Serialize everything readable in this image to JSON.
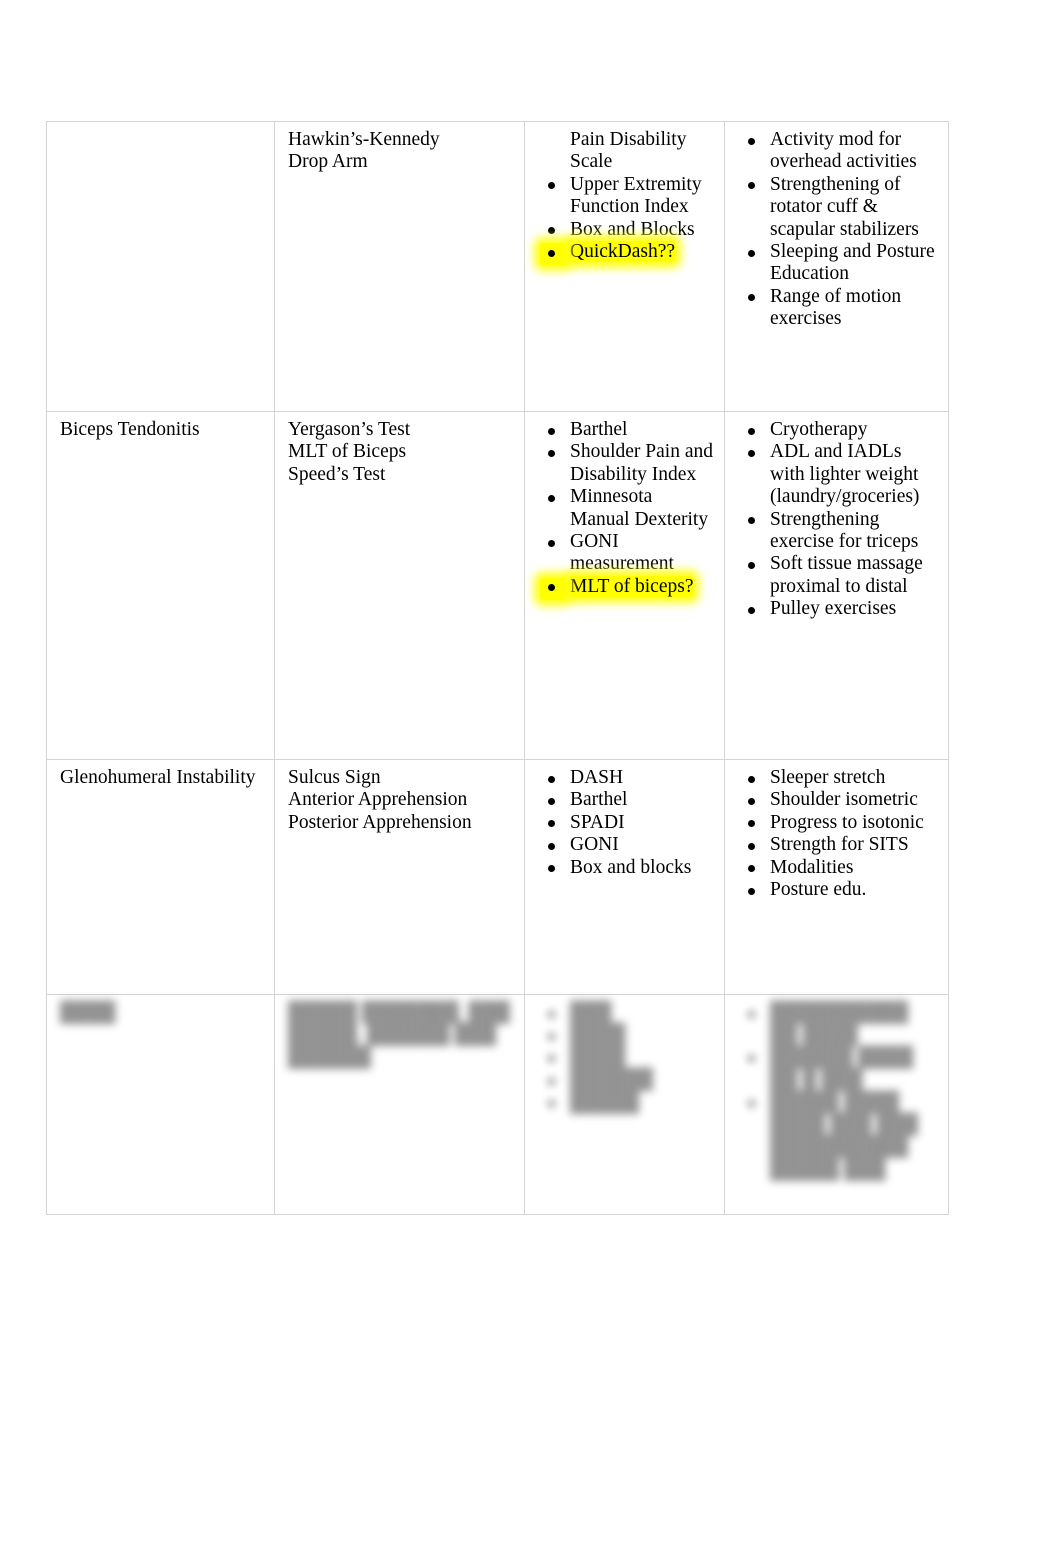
{
  "document": {
    "type": "table",
    "page_background": "#ffffff",
    "border_color": "#d4d4d4",
    "highlight_color": "#ffff00",
    "text_color": "#000000"
  },
  "table": {
    "columns": [
      {
        "key": "condition",
        "header_visible": false
      },
      {
        "key": "special_tests",
        "header_visible": false
      },
      {
        "key": "outcome_measures",
        "header_visible": false
      },
      {
        "key": "interventions",
        "header_visible": false
      }
    ],
    "rows": [
      {
        "id": "row-continued-impingement",
        "blurred": false,
        "condition": {
          "lines": []
        },
        "special_tests": {
          "lines": [
            "Hawkin’s-Kennedy",
            "Drop Arm"
          ]
        },
        "outcome_measures": {
          "items": [
            {
              "text": "Pain Disability Scale",
              "bullet": false,
              "highlight": false
            },
            {
              "text": "Upper Extremity Function Index",
              "bullet": true,
              "highlight": false
            },
            {
              "text": "Box and Blocks",
              "bullet": true,
              "highlight": false
            },
            {
              "text": "QuickDash??",
              "bullet": true,
              "highlight": true
            }
          ]
        },
        "interventions": {
          "items": [
            {
              "text": "Activity mod for overhead activities",
              "bullet": true,
              "highlight": false
            },
            {
              "text": "Strengthening of rotator cuff & scapular stabilizers",
              "bullet": true,
              "highlight": false
            },
            {
              "text": "Sleeping and Posture Education",
              "bullet": true,
              "highlight": false
            },
            {
              "text": "Range of motion exercises",
              "bullet": true,
              "highlight": false
            }
          ]
        }
      },
      {
        "id": "row-biceps-tendonitis",
        "blurred": false,
        "condition": {
          "lines": [
            "Biceps Tendonitis"
          ]
        },
        "special_tests": {
          "lines": [
            "Yergason’s Test",
            "MLT of Biceps",
            "Speed’s Test"
          ]
        },
        "outcome_measures": {
          "items": [
            {
              "text": "Barthel",
              "bullet": true,
              "highlight": false
            },
            {
              "text": "Shoulder Pain and Disability Index",
              "bullet": true,
              "highlight": false
            },
            {
              "text": "Minnesota Manual Dexterity",
              "bullet": true,
              "highlight": false
            },
            {
              "text": "GONI measurement",
              "bullet": true,
              "highlight": false
            },
            {
              "text": "MLT of biceps?",
              "bullet": true,
              "highlight": true
            }
          ]
        },
        "interventions": {
          "items": [
            {
              "text": "Cryotherapy",
              "bullet": true,
              "highlight": false
            },
            {
              "text": "ADL and IADLs with lighter weight (laundry/groceries)",
              "bullet": true,
              "highlight": false
            },
            {
              "text": "Strengthening exercise for triceps",
              "bullet": true,
              "highlight": false
            },
            {
              "text": "Soft tissue massage proximal to distal",
              "bullet": true,
              "highlight": false
            },
            {
              "text": "Pulley exercises",
              "bullet": true,
              "highlight": false
            }
          ]
        }
      },
      {
        "id": "row-glenohumeral-instability",
        "blurred": false,
        "condition": {
          "lines": [
            "Glenohumeral Instability"
          ]
        },
        "special_tests": {
          "lines": [
            "Sulcus Sign",
            "Anterior Apprehension",
            "Posterior Apprehension"
          ]
        },
        "outcome_measures": {
          "items": [
            {
              "text": "DASH",
              "bullet": true,
              "highlight": false
            },
            {
              "text": "Barthel",
              "bullet": true,
              "highlight": false
            },
            {
              "text": "SPADI",
              "bullet": true,
              "highlight": false
            },
            {
              "text": "GONI",
              "bullet": true,
              "highlight": false
            },
            {
              "text": "Box and blocks",
              "bullet": true,
              "highlight": false
            }
          ]
        },
        "interventions": {
          "items": [
            {
              "text": "Sleeper stretch",
              "bullet": true,
              "highlight": false
            },
            {
              "text": "Shoulder isometric",
              "bullet": true,
              "highlight": false
            },
            {
              "text": "Progress to isotonic",
              "bullet": true,
              "highlight": false
            },
            {
              "text": "Strength for SITS",
              "bullet": true,
              "highlight": false
            },
            {
              "text": "Modalities",
              "bullet": true,
              "highlight": false
            },
            {
              "text": "Posture edu.",
              "bullet": true,
              "highlight": false
            }
          ]
        }
      },
      {
        "id": "row-blurred",
        "blurred": true,
        "condition": {
          "lines": [
            "████"
          ]
        },
        "special_tests": {
          "lines": [
            "█████ ███████, ███",
            "█████, ██████ ███",
            "██████"
          ]
        },
        "outcome_measures": {
          "items": [
            {
              "text": "███",
              "bullet": true,
              "highlight": false
            },
            {
              "text": "████",
              "bullet": true,
              "highlight": false
            },
            {
              "text": "████",
              "bullet": true,
              "highlight": false
            },
            {
              "text": "██████",
              "bullet": true,
              "highlight": false
            },
            {
              "text": "█████",
              "bullet": true,
              "highlight": false
            }
          ]
        },
        "interventions": {
          "items": [
            {
              "text": "██████████ ██ ████",
              "bullet": true,
              "highlight": false
            },
            {
              "text": "██████ ████ ██ █ ███",
              "bullet": true,
              "highlight": false
            },
            {
              "text": "█████ ████ ████ ███ ███ ██████████ █████ ███",
              "bullet": true,
              "highlight": false
            }
          ]
        }
      }
    ]
  }
}
